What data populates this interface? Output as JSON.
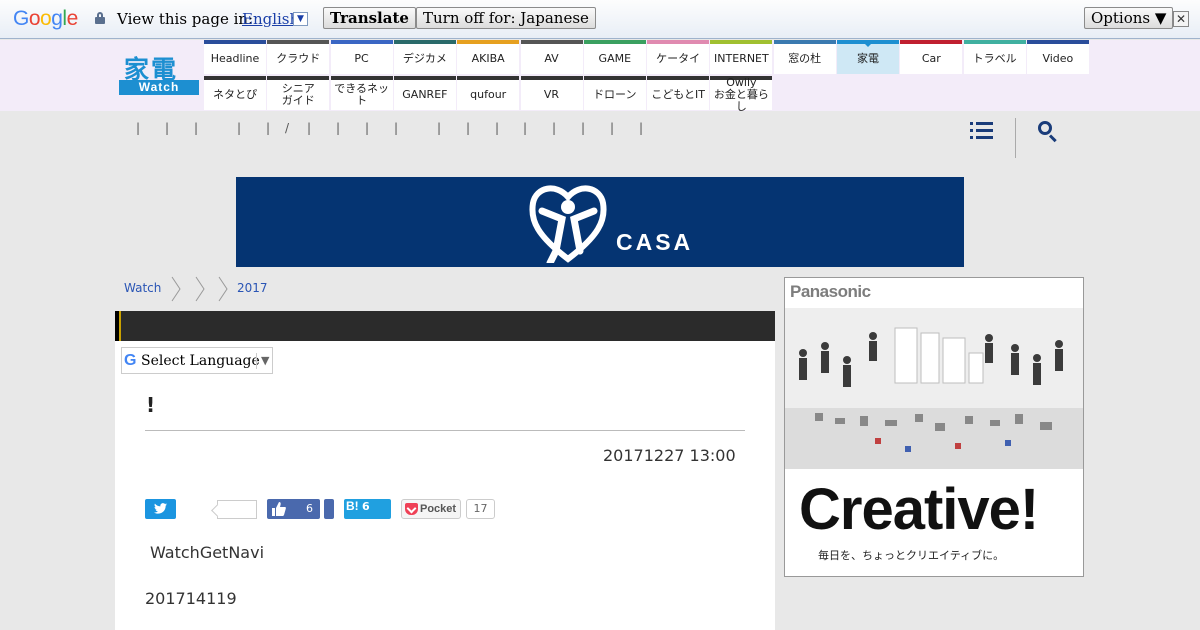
{
  "translate_bar": {
    "logo_letters": [
      "G",
      "o",
      "o",
      "g",
      "l",
      "e"
    ],
    "logo_colors": [
      "#4285f4",
      "#ea4335",
      "#fbbc05",
      "#4285f4",
      "#34a853",
      "#ea4335"
    ],
    "prompt": "View this page in:",
    "language": "English",
    "translate_button": "Translate",
    "turn_off_button": "Turn off for: Japanese",
    "options_button": "Options ▼",
    "close_label": "✕"
  },
  "site": {
    "logo_kanji": "家電",
    "logo_sub": "Watch",
    "brand_color": "#1d8fd1"
  },
  "nav_row1": [
    {
      "label": "Headline",
      "color": "#2a4d9b"
    },
    {
      "label": "クラウド",
      "color": "#555555"
    },
    {
      "label": "PC",
      "color": "#3a66c4"
    },
    {
      "label": "デジカメ",
      "color": "#2a6a6a"
    },
    {
      "label": "AKIBA",
      "color": "#e6a020"
    },
    {
      "label": "AV",
      "color": "#555555"
    },
    {
      "label": "GAME",
      "color": "#3aa060"
    },
    {
      "label": "ケータイ",
      "color": "#e08ab0"
    },
    {
      "label": "INTERNET",
      "color": "#a0c030"
    },
    {
      "label": "窓の杜",
      "color": "#3a7ab0"
    },
    {
      "label": "家電",
      "color": "#1d8fd1",
      "active": true
    },
    {
      "label": "Car",
      "color": "#c02030"
    },
    {
      "label": "トラベル",
      "color": "#40b0a0"
    },
    {
      "label": "Video",
      "color": "#2a4d9b"
    }
  ],
  "nav_row2": [
    {
      "label": "ネタとぴ",
      "color": "#333333"
    },
    {
      "label": "シニア\nガイド",
      "color": "#333333"
    },
    {
      "label": "できるネット",
      "color": "#333333"
    },
    {
      "label": "GANREF",
      "color": "#333333"
    },
    {
      "label": "qufour",
      "color": "#333333"
    },
    {
      "label": "VR",
      "color": "#333333"
    },
    {
      "label": "ドローン",
      "color": "#333333"
    },
    {
      "label": "こどもとIT",
      "color": "#333333"
    },
    {
      "label": "Owlly\nお金と暮らし",
      "color": "#333333"
    }
  ],
  "subnav_separators": [
    "|",
    "|",
    "|",
    "|",
    "|",
    "/",
    "|",
    "|",
    "|",
    "|",
    "|",
    "|",
    "|",
    "|",
    "|",
    "|",
    "|",
    "|"
  ],
  "ad_banner": {
    "brand": "CASA",
    "bg_color": "#053472"
  },
  "breadcrumb": [
    "Watch",
    "2017"
  ],
  "select_language": {
    "label": "Select Language",
    "arrow": "▼"
  },
  "article": {
    "title": "!",
    "date": "20171227 13:00",
    "body_line1": "WatchGetNavi",
    "body_line2": "201714119"
  },
  "share": {
    "facebook_count": "6",
    "hatena_label": "B!",
    "hatena_count": "6",
    "pocket_label": "Pocket",
    "pocket_count": "17"
  },
  "side_ad": {
    "brand": "Panasonic",
    "headline": "Creative!",
    "tagline": "毎日を、ちょっとクリエイティブに。"
  }
}
